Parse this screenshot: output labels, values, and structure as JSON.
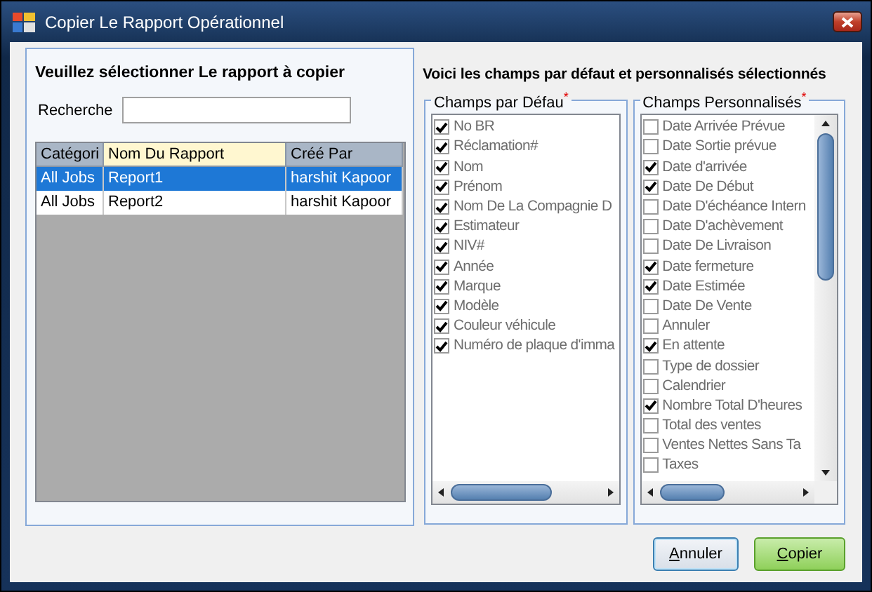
{
  "window": {
    "title": "Copier Le Rapport Opérationnel"
  },
  "report_panel": {
    "heading": "Veuillez sélectionner Le rapport à copier",
    "search": {
      "label": "Recherche"
    },
    "table": {
      "columns": [
        {
          "label": "Catégori",
          "highlighted": false
        },
        {
          "label": "Nom Du Rapport",
          "highlighted": true
        },
        {
          "label": "Créé Par",
          "highlighted": false
        }
      ],
      "rows": [
        {
          "cells": [
            "All Jobs",
            "Report1",
            "harshit Kapoor"
          ],
          "selected": true
        },
        {
          "cells": [
            "All Jobs",
            "Report2",
            "harshit Kapoor"
          ],
          "selected": false
        }
      ]
    }
  },
  "fields_panel": {
    "heading": "Voici les champs par défaut et personnalisés sélectionnés",
    "groups": [
      {
        "title": "Champs par Défau",
        "required_mark": "*",
        "items": [
          {
            "label": "No BR",
            "checked": true
          },
          {
            "label": "Réclamation#",
            "checked": true
          },
          {
            "label": "Nom",
            "checked": true
          },
          {
            "label": "Prénom",
            "checked": true
          },
          {
            "label": "Nom De La Compagnie D",
            "checked": true
          },
          {
            "label": "Estimateur",
            "checked": true
          },
          {
            "label": "NIV#",
            "checked": true
          },
          {
            "label": "Année",
            "checked": true
          },
          {
            "label": "Marque",
            "checked": true
          },
          {
            "label": "Modèle",
            "checked": true
          },
          {
            "label": "Couleur véhicule",
            "checked": true
          },
          {
            "label": "Numéro de plaque d'imma",
            "checked": true
          }
        ]
      },
      {
        "title": "Champs Personnalisés",
        "required_mark": "*",
        "items": [
          {
            "label": "Date Arrivée Prévue",
            "checked": false
          },
          {
            "label": "Date Sortie prévue",
            "checked": false
          },
          {
            "label": "Date d'arrivée",
            "checked": true
          },
          {
            "label": "Date De Début",
            "checked": true
          },
          {
            "label": "Date D'échéance Intern",
            "checked": false
          },
          {
            "label": "Date D'achèvement",
            "checked": false
          },
          {
            "label": "Date De Livraison",
            "checked": false
          },
          {
            "label": "Date fermeture",
            "checked": true
          },
          {
            "label": "Date Estimée",
            "checked": true
          },
          {
            "label": "Date De Vente",
            "checked": false
          },
          {
            "label": "Annuler",
            "checked": false
          },
          {
            "label": "En attente",
            "checked": true
          },
          {
            "label": "Type de dossier",
            "checked": false
          },
          {
            "label": "Calendrier",
            "checked": false
          },
          {
            "label": "Nombre Total D'heures",
            "checked": true
          },
          {
            "label": "Total des ventes",
            "checked": false
          },
          {
            "label": "Ventes Nettes Sans Ta",
            "checked": false
          },
          {
            "label": "Taxes",
            "checked": false
          }
        ]
      }
    ]
  },
  "buttons": [
    {
      "label": "Annuler",
      "kind": "default"
    },
    {
      "label": "Copier",
      "kind": "primary"
    }
  ]
}
